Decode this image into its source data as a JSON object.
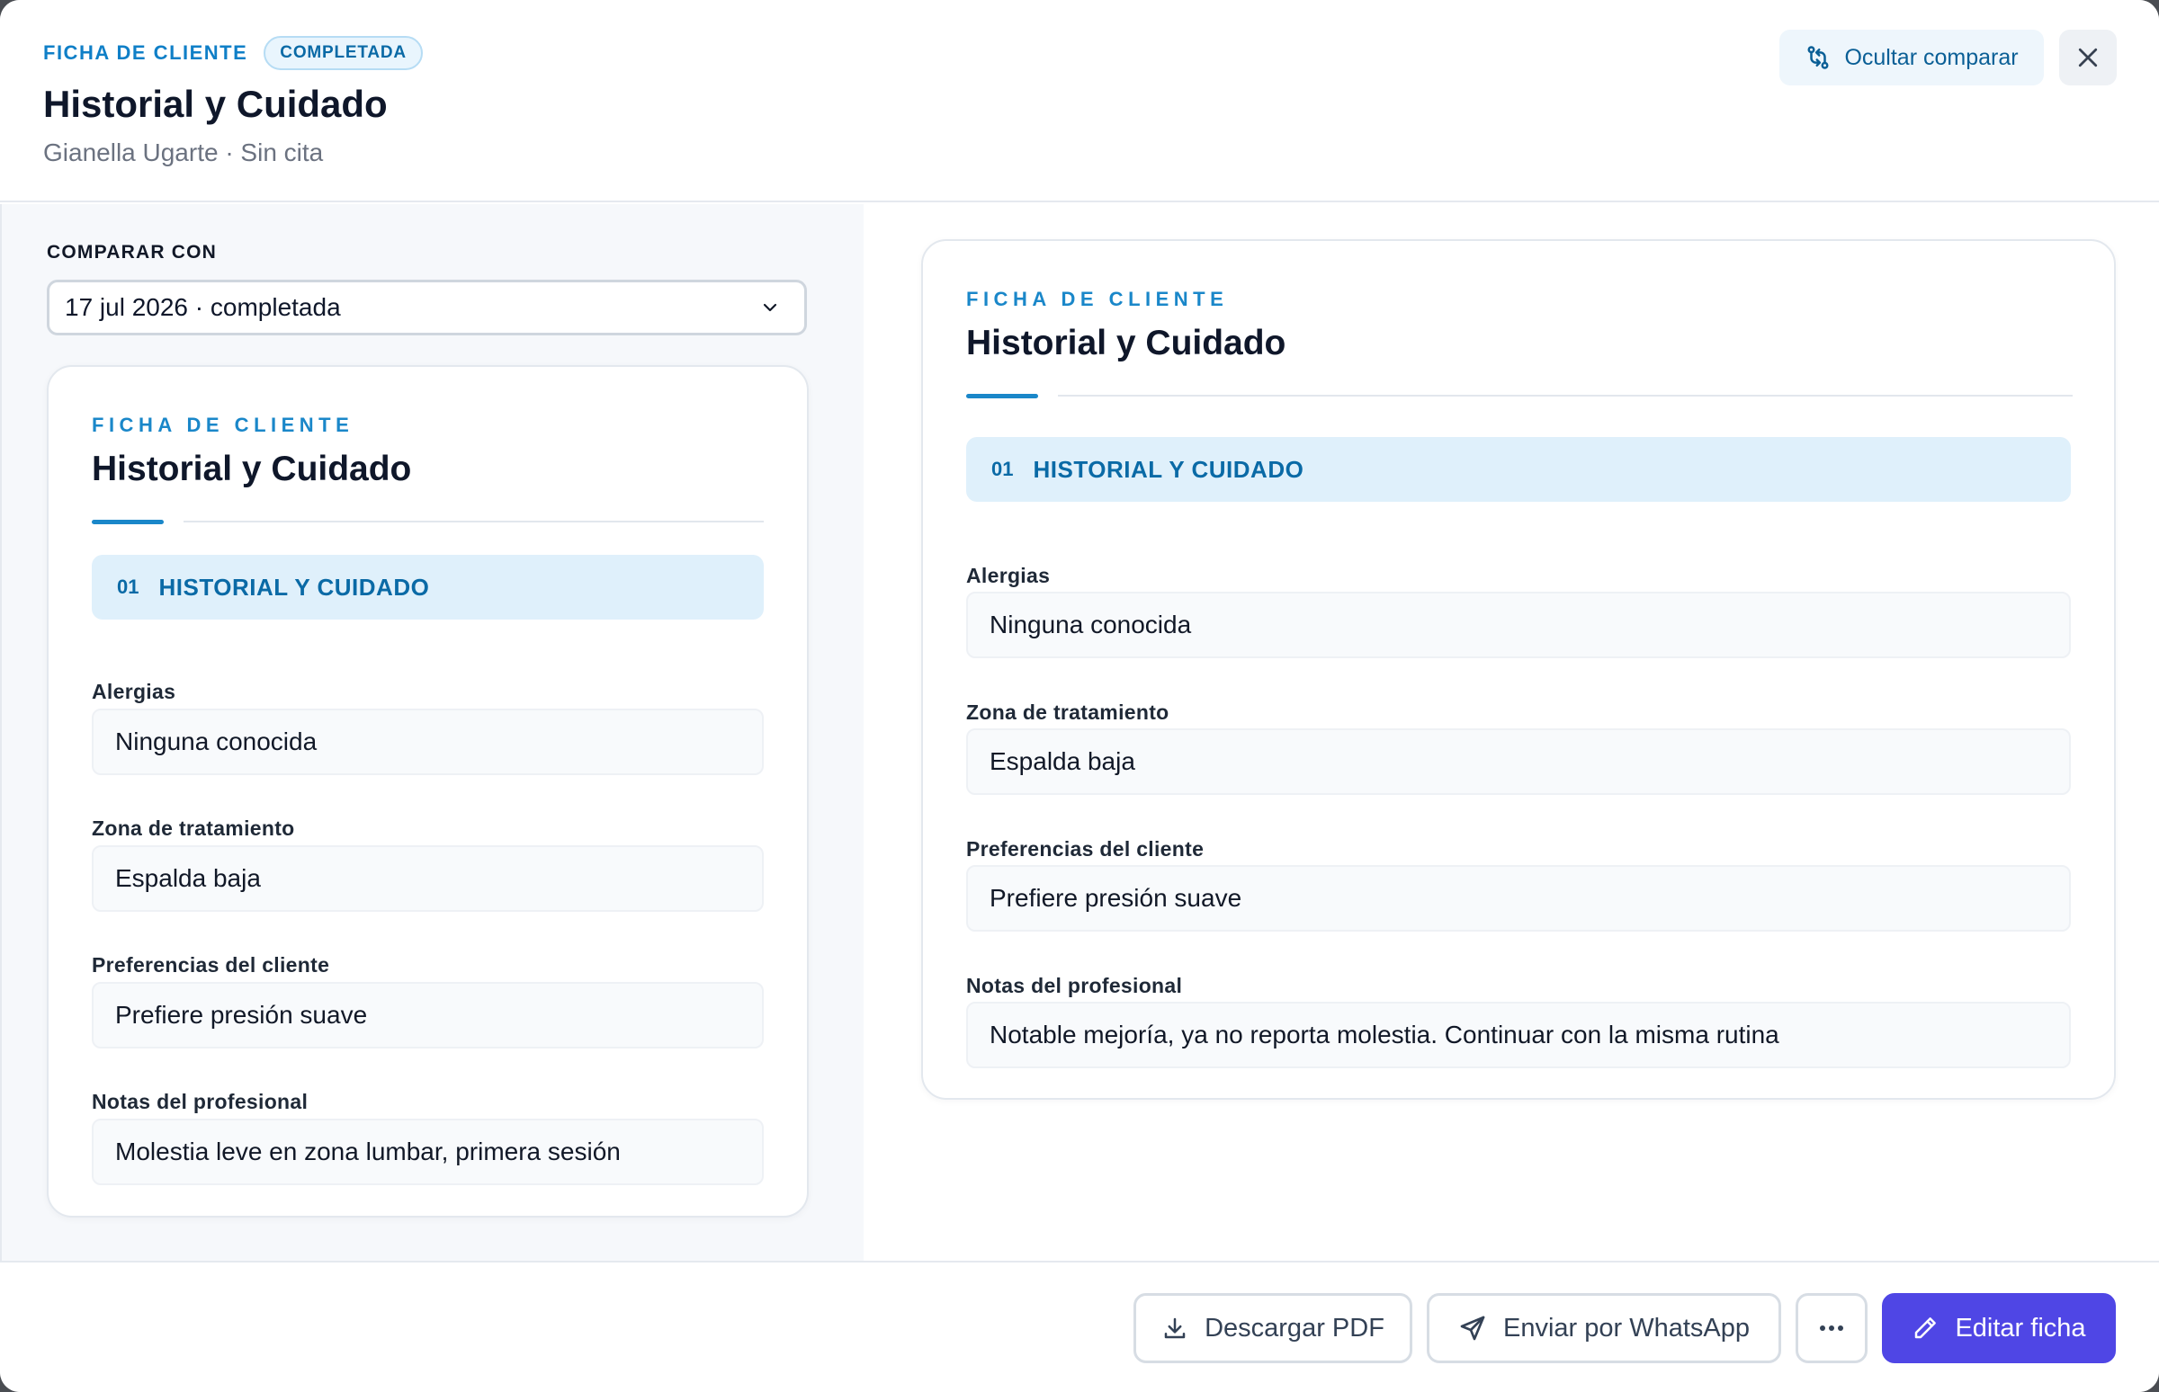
{
  "header": {
    "eyebrow": "FICHA DE CLIENTE",
    "badge": "COMPLETADA",
    "title": "Historial y Cuidado",
    "subtitle": "Gianella Ugarte · Sin cita",
    "hide_compare_label": "Ocultar comparar"
  },
  "compare": {
    "label": "COMPARAR CON",
    "selected": "17 jul 2026 · completada"
  },
  "left_card": {
    "eyebrow": "FICHA DE CLIENTE",
    "title": "Historial y Cuidado",
    "section_number": "01",
    "section_label": "HISTORIAL Y CUIDADO",
    "fields": [
      {
        "label": "Alergias",
        "value": "Ninguna conocida"
      },
      {
        "label": "Zona de tratamiento",
        "value": "Espalda baja"
      },
      {
        "label": "Preferencias del cliente",
        "value": "Prefiere presión suave"
      },
      {
        "label": "Notas del profesional",
        "value": "Molestia leve en zona lumbar, primera sesión"
      }
    ]
  },
  "right_card": {
    "eyebrow": "FICHA DE CLIENTE",
    "title": "Historial y Cuidado",
    "section_number": "01",
    "section_label": "HISTORIAL Y CUIDADO",
    "fields": [
      {
        "label": "Alergias",
        "value": "Ninguna conocida"
      },
      {
        "label": "Zona de tratamiento",
        "value": "Espalda baja"
      },
      {
        "label": "Preferencias del cliente",
        "value": "Prefiere presión suave"
      },
      {
        "label": "Notas del profesional",
        "value": "Notable mejoría, ya no reporta molestia. Continuar con la misma rutina"
      }
    ]
  },
  "footer": {
    "download_label": "Descargar PDF",
    "whatsapp_label": "Enviar por WhatsApp",
    "edit_label": "Editar ficha"
  },
  "colors": {
    "accent": "#1a87c9",
    "primary_button": "#4f46e5",
    "section_bg": "#dff0fb"
  },
  "icons": [
    "compare-icon",
    "close-icon",
    "chevron-down-icon",
    "download-icon",
    "send-icon",
    "more-icon",
    "pencil-icon"
  ]
}
